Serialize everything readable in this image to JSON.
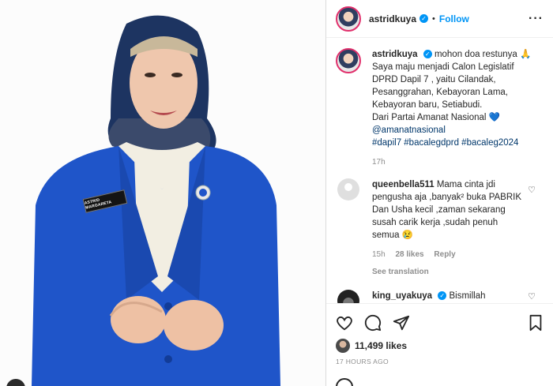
{
  "post": {
    "image_name_tag": "ASTRID MARGARETA"
  },
  "header": {
    "username": "astridkuya",
    "separator": "•",
    "follow_label": "Follow",
    "more_label": "···"
  },
  "caption": {
    "username": "astridkuya",
    "lines": [
      "mohon doa restunya 🙏",
      "Saya maju menjadi Calon Legislatif",
      "DPRD Dapil 7 , yaitu Cilandak,",
      "Pesanggrahan, Kebayoran Lama,",
      "Kebayoran baru, Setiabudi.",
      "Dari Partai Amanat Nasional 💙",
      "@amanatnasional",
      "#dapil7 #bacalegdprd #bacaleg2024"
    ],
    "time": "17h"
  },
  "comments": [
    {
      "username": "queenbella511",
      "lines": [
        "Mama cinta jdi",
        "pengusha aja ,banyak² buka PABRIK",
        "Dan Usha kecil ,zaman sekarang",
        "susah carik kerja ,sudah penuh",
        "semua 😢"
      ],
      "time": "15h",
      "likes": "28 likes",
      "reply": "Reply",
      "see_translation": "See translation"
    },
    {
      "username": "king_uyakuya",
      "text": "Bismillah"
    }
  ],
  "actions": {
    "likes": "11,499 likes",
    "timestamp": "17 HOURS AGO"
  },
  "icons": [
    "heart-icon",
    "comment-icon",
    "share-icon",
    "bookmark-icon",
    "verified-icon",
    "more-icon"
  ]
}
